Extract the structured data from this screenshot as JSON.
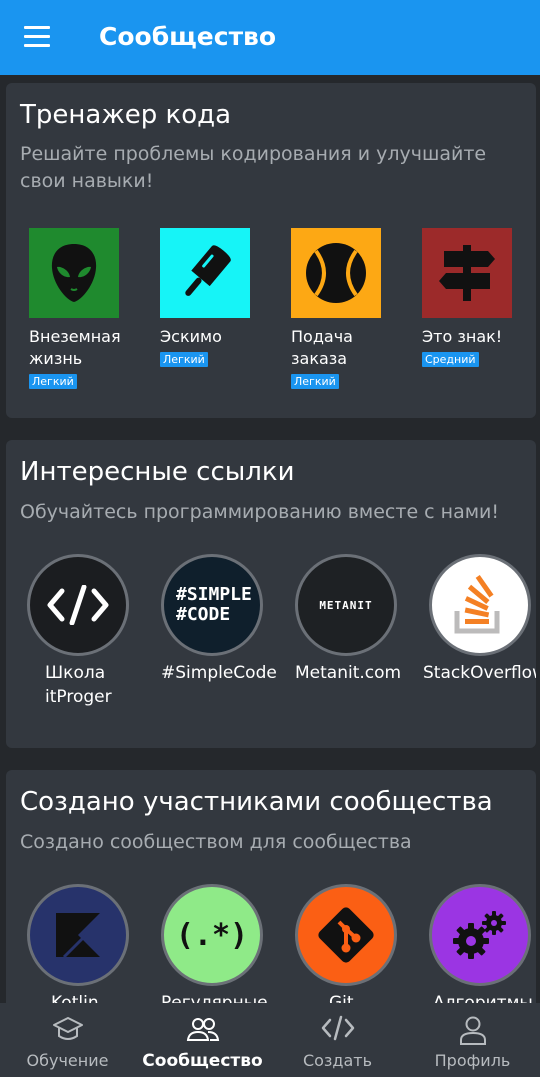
{
  "appbar": {
    "title": "Сообщество"
  },
  "code_trainer": {
    "title": "Тренажер кода",
    "subtitle": "Решайте проблемы кодирования и улучшайте свои навыки!",
    "items": [
      {
        "name": "Внеземная жизнь",
        "level": "Легкий",
        "icon": "alien-icon",
        "bg": "#1f8a2e"
      },
      {
        "name": "Эскимо",
        "level": "Легкий",
        "icon": "popsicle-icon",
        "bg": "#16f4f7"
      },
      {
        "name": "Подача заказа",
        "level": "Легкий",
        "icon": "baseball-icon",
        "bg": "#fda814"
      },
      {
        "name": "Это знак!",
        "level": "Средний",
        "icon": "signpost-icon",
        "bg": "#9c2a2a"
      }
    ]
  },
  "links": {
    "title": "Интересные ссылки",
    "subtitle": "Обучайтесь программированию вместе с нами!",
    "items": [
      {
        "name": "Школа itProger",
        "icon": "code-brackets-icon"
      },
      {
        "name": "#SimpleCode",
        "logo": "#SIMPLE #CODE",
        "icon": "simplecode-logo"
      },
      {
        "name": "Metanit.com",
        "logo": "METANIT",
        "icon": "metanit-logo"
      },
      {
        "name": "StackOverflow",
        "icon": "stackoverflow-icon"
      }
    ]
  },
  "community": {
    "title": "Создано участниками сообщества",
    "subtitle": "Создано сообществом для сообщества",
    "items": [
      {
        "name": "Kotlin",
        "icon": "kotlin-icon"
      },
      {
        "name": "Регулярные",
        "logo": "(.*)",
        "icon": "regex-icon"
      },
      {
        "name": "Git",
        "icon": "git-icon"
      },
      {
        "name": "Алгоритмы",
        "icon": "gears-icon"
      }
    ]
  },
  "bottom_nav": [
    {
      "label": "Обучение",
      "icon": "graduation-cap-icon"
    },
    {
      "label": "Сообщество",
      "icon": "people-icon",
      "active": true
    },
    {
      "label": "Создать",
      "icon": "code-icon"
    },
    {
      "label": "Профиль",
      "icon": "profile-icon"
    }
  ]
}
